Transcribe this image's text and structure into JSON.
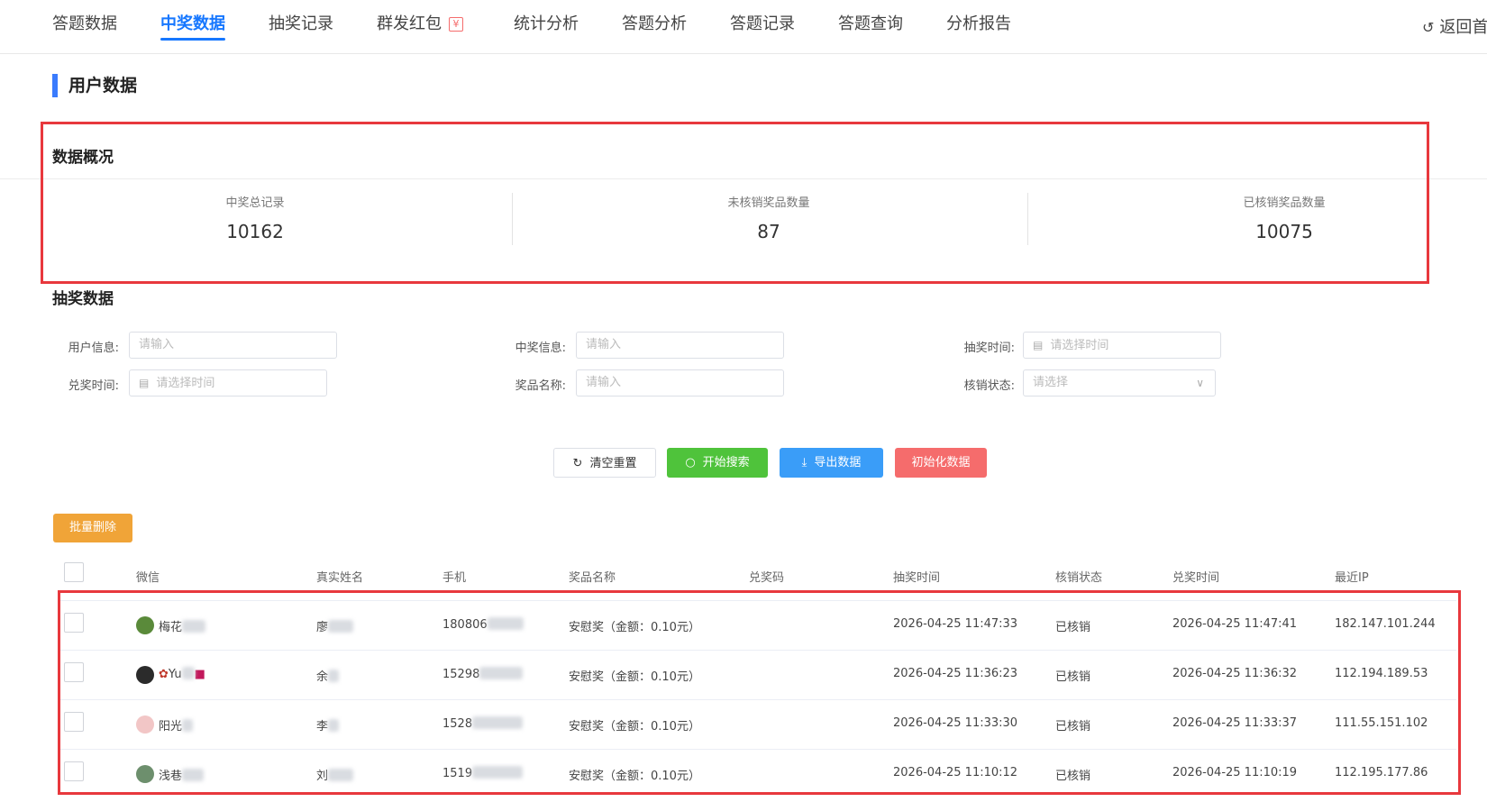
{
  "nav": {
    "tabs": [
      {
        "label": "答题数据"
      },
      {
        "label": "中奖数据"
      },
      {
        "label": "抽奖记录"
      },
      {
        "label": "群发红包"
      },
      {
        "label": "统计分析"
      },
      {
        "label": "答题分析"
      },
      {
        "label": "答题记录"
      },
      {
        "label": "答题查询"
      },
      {
        "label": "分析报告"
      }
    ],
    "active_tab": "中奖数据",
    "back_label": "返回首",
    "yen_badge": "¥"
  },
  "page_title": "用户数据",
  "overview": {
    "title": "数据概况",
    "stats": [
      {
        "label": "中奖总记录",
        "value": "10162"
      },
      {
        "label": "未核销奖品数量",
        "value": "87"
      },
      {
        "label": "已核销奖品数量",
        "value": "10075"
      }
    ]
  },
  "lottery": {
    "title": "抽奖数据",
    "filters": {
      "user_info": {
        "label": "用户信息:",
        "placeholder": "请输入"
      },
      "prize_info": {
        "label": "中奖信息:",
        "placeholder": "请输入"
      },
      "draw_time": {
        "label": "抽奖时间:",
        "placeholder": "请选择时间"
      },
      "redeem_time": {
        "label": "兑奖时间:",
        "placeholder": "请选择时间"
      },
      "prize_name": {
        "label": "奖品名称:",
        "placeholder": "请输入"
      },
      "verify_status": {
        "label": "核销状态:",
        "placeholder": "请选择"
      }
    },
    "buttons": {
      "reset": "清空重置",
      "search": "开始搜索",
      "export": "导出数据",
      "init": "初始化数据",
      "batch_delete": "批量删除"
    }
  },
  "table": {
    "headers": [
      "微信",
      "真实姓名",
      "手机",
      "奖品名称",
      "兑奖码",
      "抽奖时间",
      "核销状态",
      "兑奖时间",
      "最近IP"
    ],
    "rows": [
      {
        "wechat": "梅花",
        "name": "廖",
        "phone": "180806",
        "prize": "安慰奖（金额：0.10元）",
        "code": "",
        "draw_time": "2026-04-25 11:47:33",
        "status": "已核销",
        "redeem_time": "2026-04-25 11:47:41",
        "ip": "182.147.101.244"
      },
      {
        "wechat": "Yu",
        "name": "余",
        "phone": "15298",
        "prize": "安慰奖（金额：0.10元）",
        "code": "",
        "draw_time": "2026-04-25 11:36:23",
        "status": "已核销",
        "redeem_time": "2026-04-25 11:36:32",
        "ip": "112.194.189.53"
      },
      {
        "wechat": "阳光",
        "name": "李",
        "phone": "1528",
        "prize": "安慰奖（金额：0.10元）",
        "code": "",
        "draw_time": "2026-04-25 11:33:30",
        "status": "已核销",
        "redeem_time": "2026-04-25 11:33:37",
        "ip": "111.55.151.102"
      },
      {
        "wechat": "浅巷",
        "name": "刘",
        "phone": "1519",
        "prize": "安慰奖（金额：0.10元）",
        "code": "",
        "draw_time": "2026-04-25 11:10:12",
        "status": "已核销",
        "redeem_time": "2026-04-25 11:10:19",
        "ip": "112.195.177.86"
      }
    ]
  },
  "colors": {
    "accent": "#1677ff",
    "highlight_box": "#e8383d",
    "search_button": "#4fc33b",
    "export_button": "#3a9df8",
    "init_button": "#f56c6c",
    "batch_button": "#f0a438"
  }
}
